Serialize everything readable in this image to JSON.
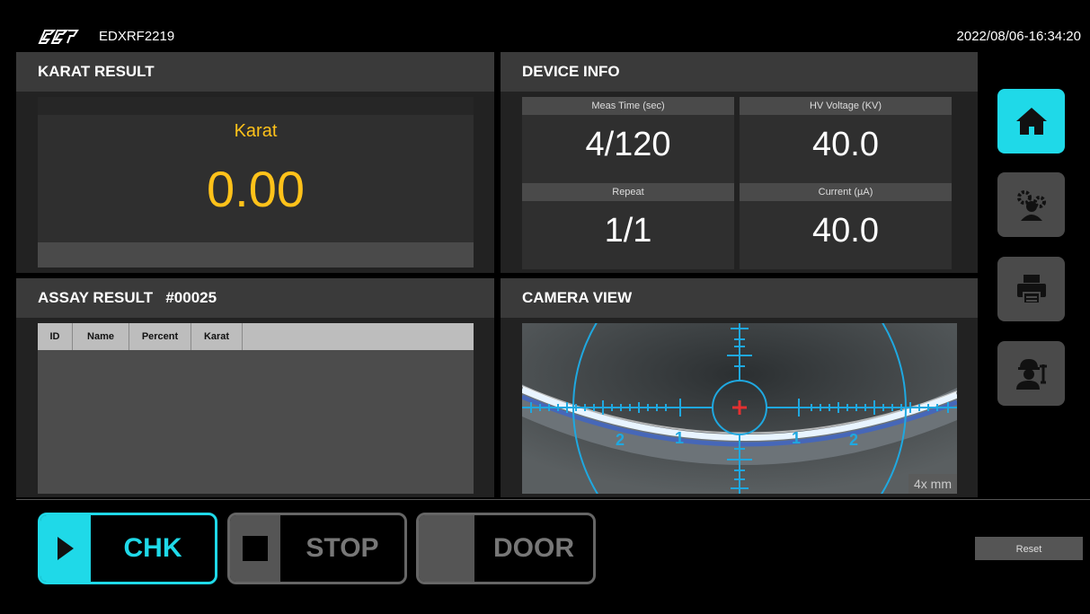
{
  "header": {
    "device_id": "EDXRF2219",
    "datetime": "2022/08/06-16:34:20"
  },
  "karat_result": {
    "title": "KARAT RESULT",
    "label": "Karat",
    "value": "0.00",
    "accent_color": "#ffc21a"
  },
  "device_info": {
    "title": "DEVICE INFO",
    "cards": [
      {
        "label": "Meas Time (sec)",
        "value": "4/120"
      },
      {
        "label": "HV Voltage (KV)",
        "value": "40.0"
      },
      {
        "label": "Repeat",
        "value": "1/1"
      },
      {
        "label": "Current (µA)",
        "value": "40.0"
      }
    ]
  },
  "assay_result": {
    "title": "ASSAY RESULT   #00025",
    "columns": [
      "ID",
      "Name",
      "Percent",
      "Karat"
    ],
    "rows": []
  },
  "camera_view": {
    "title": "CAMERA VIEW",
    "zoom_label": "4x mm",
    "scale_labels": [
      "2",
      "1",
      "1",
      "2"
    ]
  },
  "side_nav": [
    {
      "name": "home-icon",
      "active": true
    },
    {
      "name": "settings-user-icon",
      "active": false
    },
    {
      "name": "printer-icon",
      "active": false
    },
    {
      "name": "engineer-icon",
      "active": false
    }
  ],
  "actions": {
    "chk": "CHK",
    "stop": "STOP",
    "door": "DOOR",
    "reset": "Reset"
  },
  "colors": {
    "accent": "#1fd9e8",
    "karat": "#ffc21a",
    "reticle": "#1fa8e0",
    "crosshair_center": "#e53030"
  }
}
